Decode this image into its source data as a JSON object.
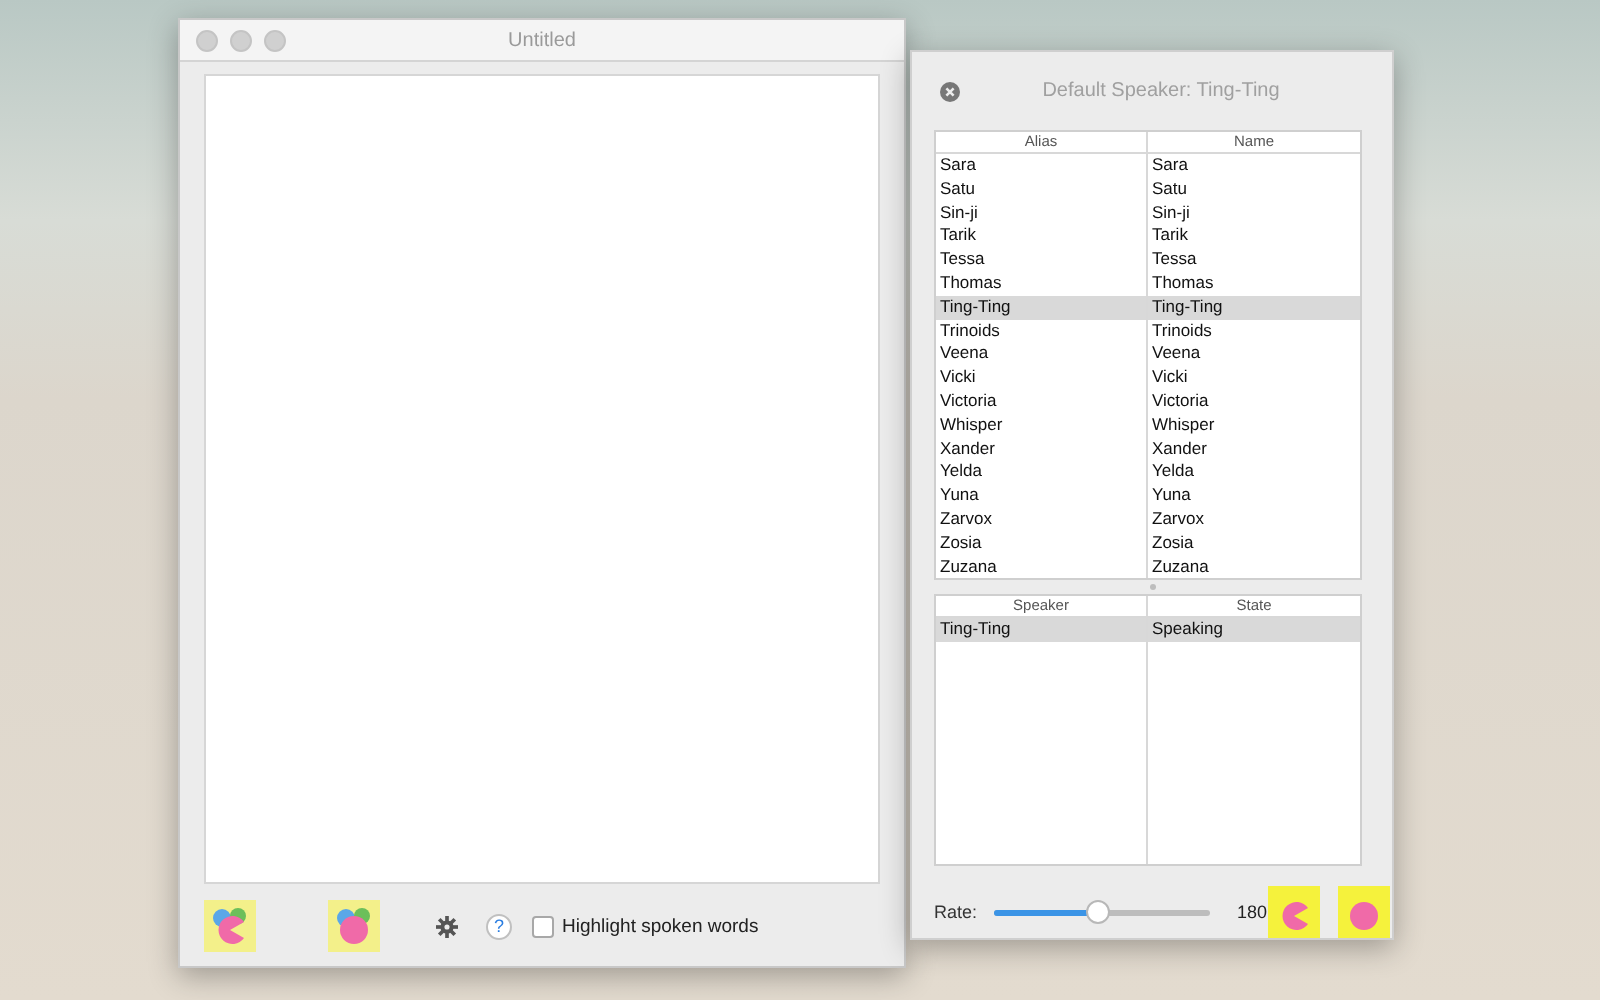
{
  "document_window": {
    "title": "Untitled",
    "help_button": "?",
    "highlight_option": {
      "label": "Highlight spoken words",
      "checked": false
    }
  },
  "speaker_panel": {
    "title": "Default Speaker: Ting-Ting",
    "voices": {
      "columns": [
        "Alias",
        "Name"
      ],
      "rows": [
        {
          "alias": "Sara",
          "name": "Sara",
          "selected": false
        },
        {
          "alias": "Satu",
          "name": "Satu",
          "selected": false
        },
        {
          "alias": "Sin-ji",
          "name": "Sin-ji",
          "selected": false
        },
        {
          "alias": "Tarik",
          "name": "Tarik",
          "selected": false
        },
        {
          "alias": "Tessa",
          "name": "Tessa",
          "selected": false
        },
        {
          "alias": "Thomas",
          "name": "Thomas",
          "selected": false
        },
        {
          "alias": "Ting-Ting",
          "name": "Ting-Ting",
          "selected": true
        },
        {
          "alias": "Trinoids",
          "name": "Trinoids",
          "selected": false
        },
        {
          "alias": "Veena",
          "name": "Veena",
          "selected": false
        },
        {
          "alias": "Vicki",
          "name": "Vicki",
          "selected": false
        },
        {
          "alias": "Victoria",
          "name": "Victoria",
          "selected": false
        },
        {
          "alias": "Whisper",
          "name": "Whisper",
          "selected": false
        },
        {
          "alias": "Xander",
          "name": "Xander",
          "selected": false
        },
        {
          "alias": "Yelda",
          "name": "Yelda",
          "selected": false
        },
        {
          "alias": "Yuna",
          "name": "Yuna",
          "selected": false
        },
        {
          "alias": "Zarvox",
          "name": "Zarvox",
          "selected": false
        },
        {
          "alias": "Zosia",
          "name": "Zosia",
          "selected": false
        },
        {
          "alias": "Zuzana",
          "name": "Zuzana",
          "selected": false
        }
      ]
    },
    "speakers": {
      "columns": [
        "Speaker",
        "State"
      ],
      "rows": [
        {
          "speaker": "Ting-Ting",
          "state": "Speaking",
          "selected": true
        }
      ]
    },
    "rate": {
      "label": "Rate:",
      "level": 0.49,
      "reading": "180"
    }
  }
}
